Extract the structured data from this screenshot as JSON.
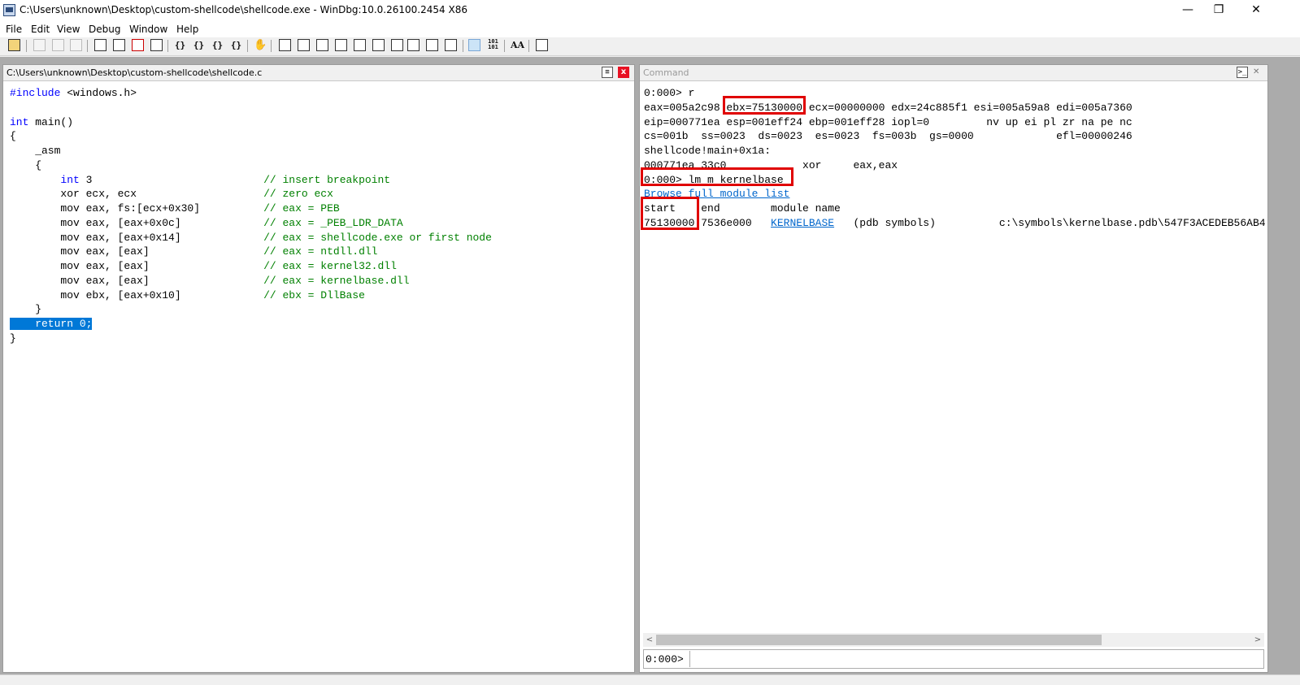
{
  "window": {
    "title": "C:\\Users\\unknown\\Desktop\\custom-shellcode\\shellcode.exe - WinDbg:10.0.26100.2454 X86",
    "minimize": "—",
    "maximize": "❐",
    "close": "✕"
  },
  "menu": [
    "File",
    "Edit",
    "View",
    "Debug",
    "Window",
    "Help"
  ],
  "source_pane": {
    "title": "C:\\Users\\unknown\\Desktop\\custom-shellcode\\shellcode.c",
    "close": "x",
    "lines": [
      {
        "pre": "",
        "kw": "#include",
        "rest": " <windows.h>",
        "comment": ""
      },
      {
        "pre": "",
        "kw": "",
        "rest": "",
        "comment": ""
      },
      {
        "pre": "",
        "kw": "int",
        "rest": " main()",
        "comment": ""
      },
      {
        "pre": "{",
        "kw": "",
        "rest": "",
        "comment": ""
      },
      {
        "pre": "    _asm",
        "kw": "",
        "rest": "",
        "comment": ""
      },
      {
        "pre": "    {",
        "kw": "",
        "rest": "",
        "comment": ""
      },
      {
        "pre": "        ",
        "kw": "int",
        "rest": " 3                           ",
        "comment": "// insert breakpoint"
      },
      {
        "pre": "        xor ecx, ecx                    ",
        "kw": "",
        "rest": "",
        "comment": "// zero ecx"
      },
      {
        "pre": "        mov eax, fs:[ecx+0x30]          ",
        "kw": "",
        "rest": "",
        "comment": "// eax = PEB"
      },
      {
        "pre": "        mov eax, [eax+0x0c]             ",
        "kw": "",
        "rest": "",
        "comment": "// eax = _PEB_LDR_DATA"
      },
      {
        "pre": "        mov eax, [eax+0x14]             ",
        "kw": "",
        "rest": "",
        "comment": "// eax = shellcode.exe or first node"
      },
      {
        "pre": "        mov eax, [eax]                  ",
        "kw": "",
        "rest": "",
        "comment": "// eax = ntdll.dll"
      },
      {
        "pre": "        mov eax, [eax]                  ",
        "kw": "",
        "rest": "",
        "comment": "// eax = kernel32.dll"
      },
      {
        "pre": "        mov eax, [eax]                  ",
        "kw": "",
        "rest": "",
        "comment": "// eax = kernelbase.dll"
      },
      {
        "pre": "        mov ebx, [eax+0x10]             ",
        "kw": "",
        "rest": "",
        "comment": "// ebx = DllBase"
      },
      {
        "pre": "    }",
        "kw": "",
        "rest": "",
        "comment": ""
      }
    ],
    "highlighted_line": "    return 0;",
    "last_line": "}"
  },
  "command_pane": {
    "title": "Command",
    "output": {
      "cmd_r": "0:000> r",
      "reg1_a": "eax=005a2c98 ",
      "reg1_ebx": "ebx=75130000",
      "reg1_b": " ecx=00000000 edx=24c885f1 esi=005a59a8 edi=005a7360",
      "reg2": "eip=000771ea esp=001eff24 ebp=001eff28 iopl=0         nv up ei pl zr na pe nc",
      "reg3": "cs=001b  ss=0023  ds=0023  es=0023  fs=003b  gs=0000             efl=00000246",
      "sym": "shellcode!main+0x1a:",
      "disasm": "000771ea 33c0            xor     eax,eax",
      "cmd_lm": "0:000> lm m kernelbase",
      "browse_link": "Browse full module list",
      "header": "start    end        module name",
      "mod_start": "75130000",
      "mod_end": " 7536e000   ",
      "mod_name": "KERNELBASE",
      "mod_rest": "   (pdb symbols)          c:\\symbols\\kernelbase.pdb\\547F3ACEDEB56AB4"
    },
    "prompt": "0:000>",
    "input_value": ""
  }
}
